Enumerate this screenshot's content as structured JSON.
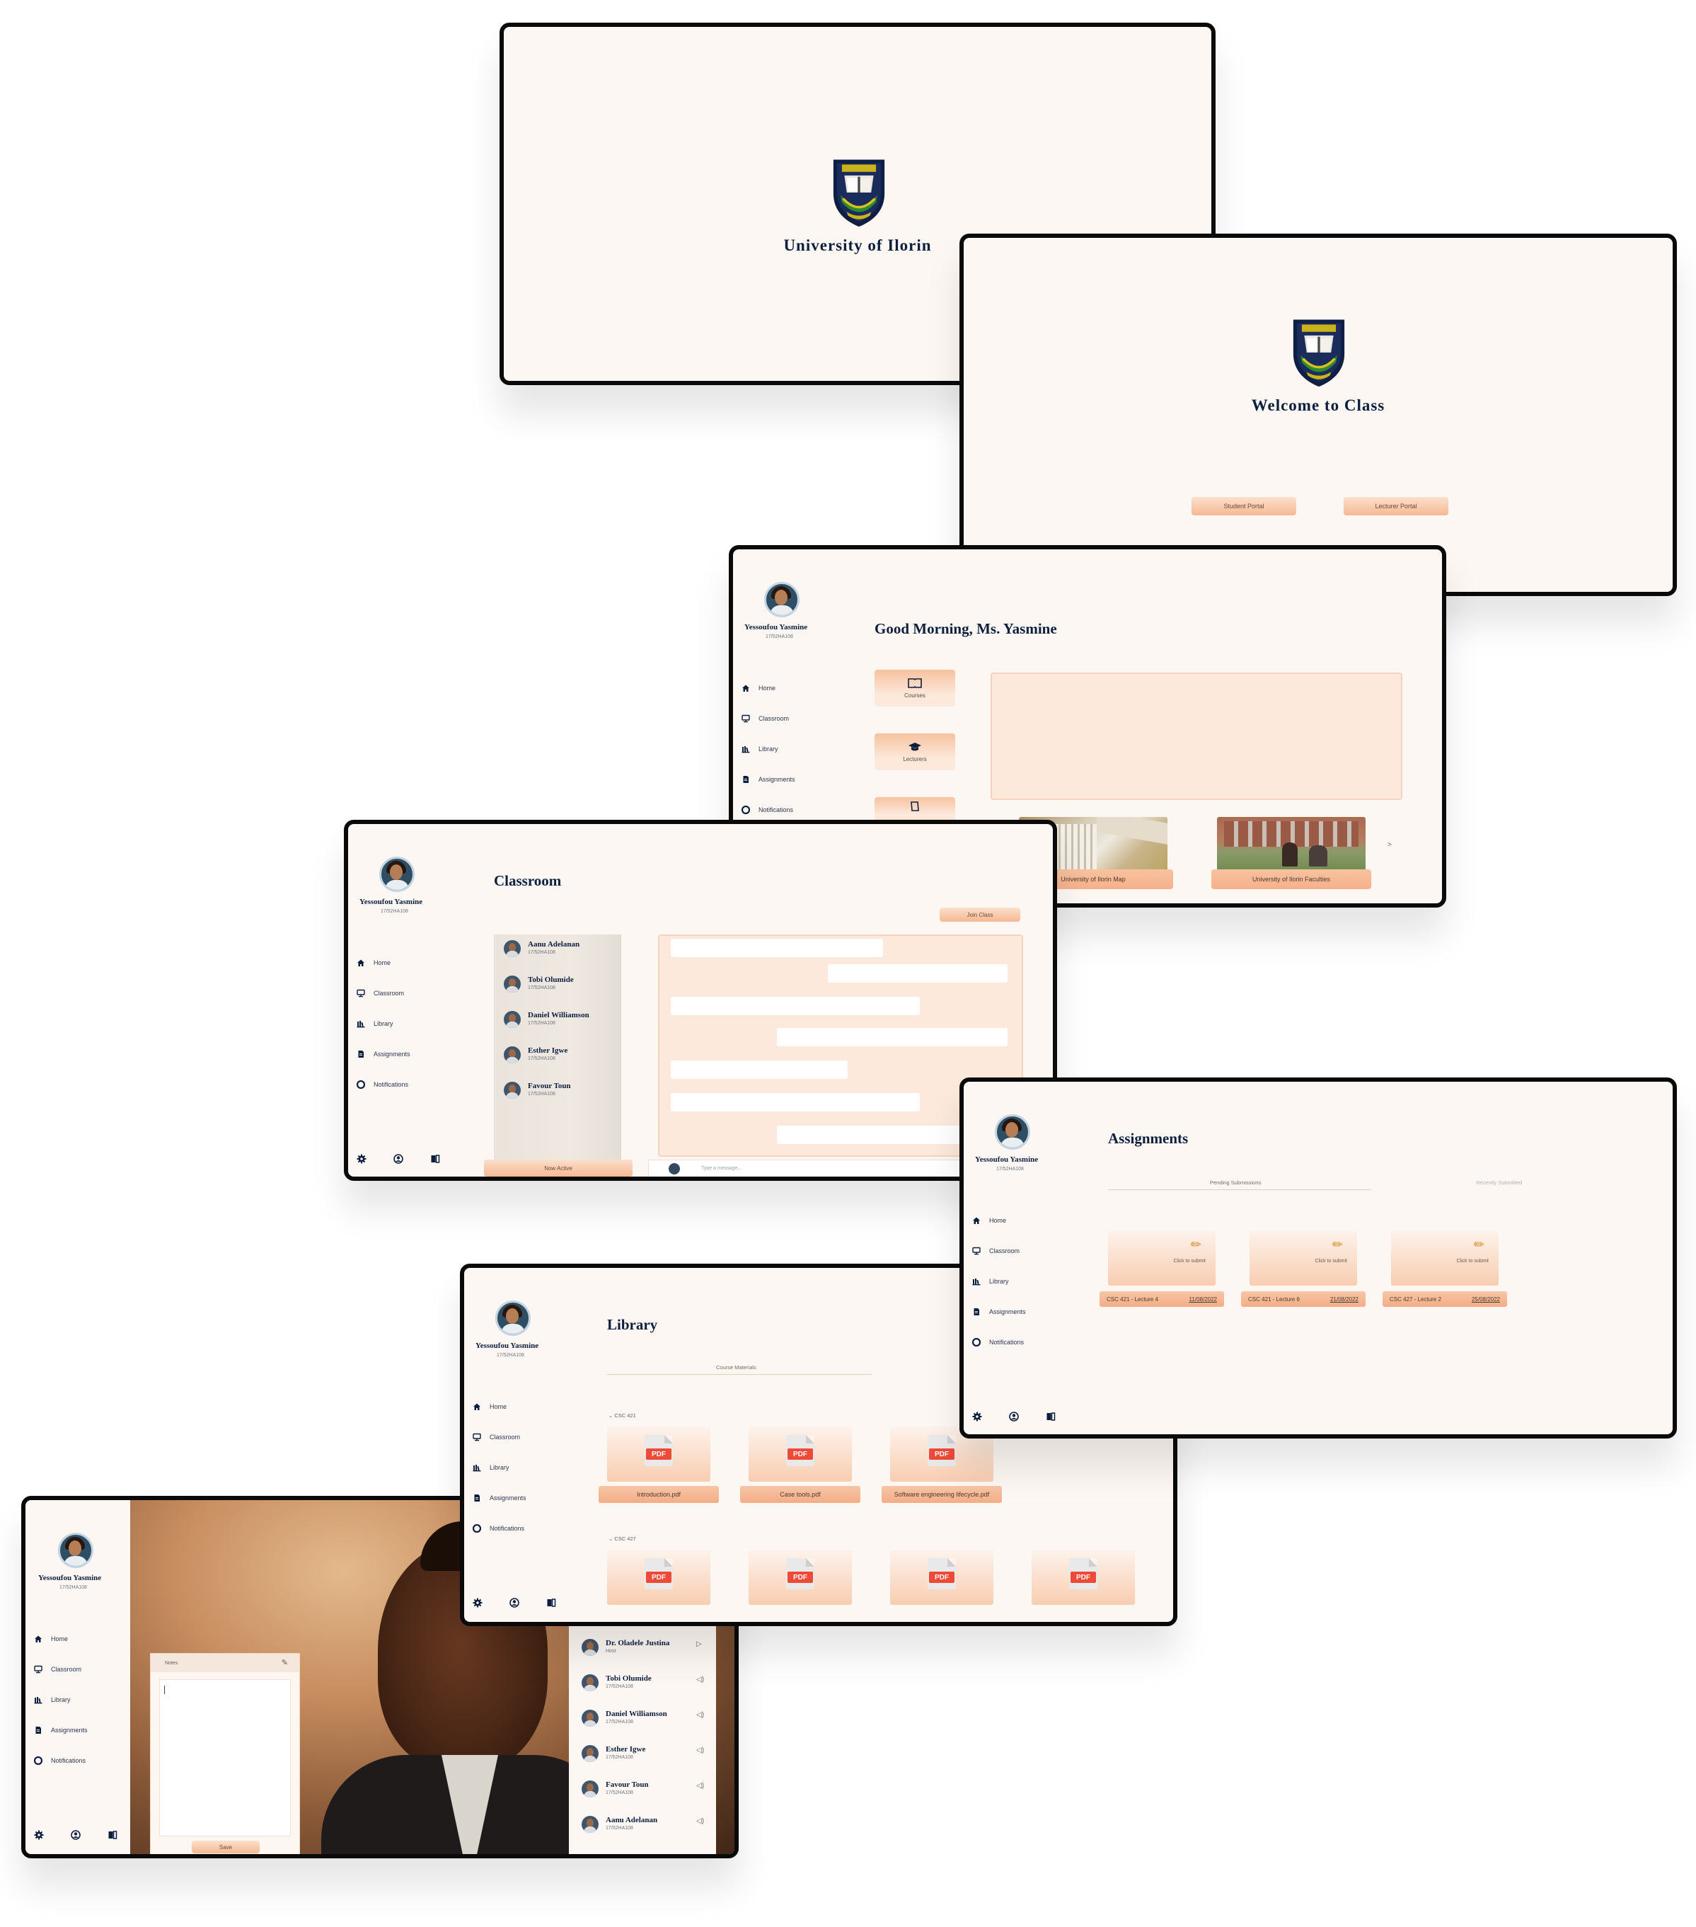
{
  "colors": {
    "navy": "#0c1f3f",
    "cream": "#fdf7f3",
    "peach": "#f6b891",
    "peach_light": "#fde8dc",
    "pdf_red": "#ee4a37",
    "frame": "#0a0a0a"
  },
  "splash": {
    "title": "University of Ilorin"
  },
  "welcome": {
    "title": "Welcome to Class",
    "student_button": "Student Portal",
    "lecturer_button": "Lecturer Portal"
  },
  "user": {
    "name": "Yessoufou Yasmine",
    "id": "17/52HA108"
  },
  "nav": {
    "home": "Home",
    "classroom": "Classroom",
    "library": "Library",
    "assignments": "Assignments",
    "notifications": "Notifications"
  },
  "icons": {
    "home": "home-icon",
    "classroom": "monitor-icon",
    "library": "books-icon",
    "assignments": "document-icon",
    "notifications": "bell-icon",
    "settings": "gear-icon",
    "profile": "user-circle-icon",
    "logout": "exit-icon"
  },
  "home": {
    "greeting": "Good Morning, Ms. Yasmine",
    "tiles": [
      {
        "label": "Courses",
        "icon": "book-icon"
      },
      {
        "label": "Lecturers",
        "icon": "graduation-cap-icon"
      },
      {
        "label": "",
        "icon": "notebook-icon"
      }
    ],
    "photos": [
      {
        "label": "University of Ilorin Map"
      },
      {
        "label": "University of Ilorin Faculties"
      }
    ],
    "next": ">"
  },
  "classroom": {
    "title": "Classroom",
    "join_button": "Join Class",
    "students": [
      {
        "name": "Aanu Adelanan",
        "id": "17/52HA108"
      },
      {
        "name": "Tobi Olumide",
        "id": "17/52HA108"
      },
      {
        "name": "Daniel Williamson",
        "id": "17/52HA108"
      },
      {
        "name": "Esther Igwe",
        "id": "17/52HA108"
      },
      {
        "name": "Favour Toun",
        "id": "17/52HA108"
      }
    ],
    "now_active": "Now Active",
    "message_placeholder": "Type a message..."
  },
  "assignments": {
    "title": "Assignments",
    "tab_pending": "Pending Submissions",
    "tab_recent": "Recently Submitted",
    "hint": "Click to submit",
    "items": [
      {
        "course": "CSC 421 - Lecture 4",
        "date": "11/08/2022"
      },
      {
        "course": "CSC 421 - Lecture 6",
        "date": "21/08/2022"
      },
      {
        "course": "CSC 427 - Lecture 2",
        "date": "25/08/2022"
      }
    ]
  },
  "library": {
    "title": "Library",
    "tab": "Course Materials",
    "group1": "CSC 421",
    "group2": "CSC 427",
    "pdf_tag": "PDF",
    "files1": [
      "Introduction.pdf",
      "Case tools.pdf",
      "Software engineering lifecycle.pdf"
    ],
    "files2": [
      "",
      "",
      "",
      ""
    ]
  },
  "call": {
    "notes_title": "Notes",
    "save": "Save",
    "participants": [
      {
        "name": "Dr. Oladele Justina",
        "id": "Host"
      },
      {
        "name": "Tobi Olumide",
        "id": "17/52HA108"
      },
      {
        "name": "Daniel Williamson",
        "id": "17/52HA108"
      },
      {
        "name": "Esther Igwe",
        "id": "17/52HA108"
      },
      {
        "name": "Favour Toun",
        "id": "17/52HA108"
      },
      {
        "name": "Aanu Adelanan",
        "id": "17/52HA108"
      }
    ]
  }
}
